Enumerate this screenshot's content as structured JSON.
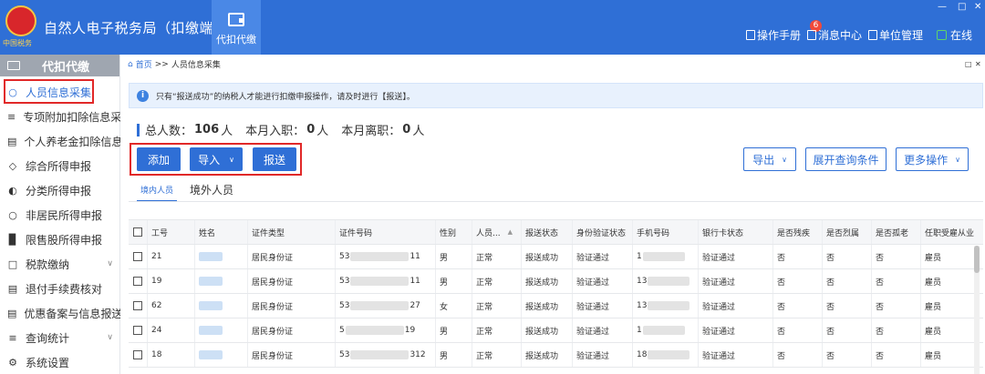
{
  "app": {
    "logo_text": "中国税务",
    "title": "自然人电子税务局（扣缴端）",
    "nav_tab": "代扣代缴"
  },
  "top_right": {
    "manual": "操作手册",
    "messages": "消息中心",
    "message_count": "6",
    "unit_mgmt": "单位管理",
    "online": "在线"
  },
  "sidebar": {
    "header": "代扣代缴",
    "items": [
      {
        "label": "人员信息采集",
        "icon": "person-icon"
      },
      {
        "label": "专项附加扣除信息采集",
        "icon": "list-icon"
      },
      {
        "label": "个人养老金扣除信息",
        "icon": "document-icon"
      },
      {
        "label": "综合所得申报",
        "icon": "layers-icon"
      },
      {
        "label": "分类所得申报",
        "icon": "pie-icon"
      },
      {
        "label": "非居民所得申报",
        "icon": "person-icon"
      },
      {
        "label": "限售股所得申报",
        "icon": "bar-chart-icon"
      },
      {
        "label": "税款缴纳",
        "icon": "folder-icon"
      },
      {
        "label": "退付手续费核对",
        "icon": "receipt-icon"
      },
      {
        "label": "优惠备案与信息报送",
        "icon": "document-icon"
      },
      {
        "label": "查询统计",
        "icon": "search-list-icon"
      },
      {
        "label": "系统设置",
        "icon": "gear-icon"
      }
    ]
  },
  "breadcrumb": {
    "home": "首页",
    "sep": ">>",
    "current": "人员信息采集"
  },
  "notice": "只有“报送成功”的纳税人才能进行扣缴申报操作，请及时进行【报送】。",
  "stats": {
    "total_label": "总人数：",
    "total": "106",
    "total_unit": "人",
    "hired_label": "本月入职：",
    "hired": "0",
    "hired_unit": "人",
    "left_label": "本月离职：",
    "left": "0",
    "left_unit": "人"
  },
  "buttons": {
    "add": "添加",
    "import": "导入",
    "submit": "报送",
    "export": "导出",
    "expand_query": "展开查询条件",
    "more_ops": "更多操作"
  },
  "tabs": [
    "境内人员",
    "境外人员"
  ],
  "table": {
    "headers": [
      "工号",
      "姓名",
      "证件类型",
      "证件号码",
      "性别",
      "人员...",
      "报送状态",
      "身份验证状态",
      "手机号码",
      "银行卡状态",
      "是否残疾",
      "是否烈属",
      "是否孤老",
      "任职受雇从业"
    ],
    "rows": [
      {
        "id": "21",
        "id_type": "居民身份证",
        "id_prefix": "53",
        "id_suffix": "11",
        "gender": "男",
        "status": "正常",
        "submit": "报送成功",
        "verify": "验证通过",
        "phone_prefix": "1",
        "bank": "验证通过",
        "disabled": "否",
        "martyr": "否",
        "elderly": "否",
        "employ": "雇员"
      },
      {
        "id": "19",
        "id_type": "居民身份证",
        "id_prefix": "53",
        "id_suffix": "11",
        "gender": "男",
        "status": "正常",
        "submit": "报送成功",
        "verify": "验证通过",
        "phone_prefix": "13",
        "bank": "验证通过",
        "disabled": "否",
        "martyr": "否",
        "elderly": "否",
        "employ": "雇员"
      },
      {
        "id": "62",
        "id_type": "居民身份证",
        "id_prefix": "53",
        "id_suffix": "27",
        "gender": "女",
        "status": "正常",
        "submit": "报送成功",
        "verify": "验证通过",
        "phone_prefix": "13",
        "bank": "验证通过",
        "disabled": "否",
        "martyr": "否",
        "elderly": "否",
        "employ": "雇员"
      },
      {
        "id": "24",
        "id_type": "居民身份证",
        "id_prefix": "5",
        "id_suffix": "19",
        "gender": "男",
        "status": "正常",
        "submit": "报送成功",
        "verify": "验证通过",
        "phone_prefix": "1",
        "bank": "验证通过",
        "disabled": "否",
        "martyr": "否",
        "elderly": "否",
        "employ": "雇员"
      },
      {
        "id": "18",
        "id_type": "居民身份证",
        "id_prefix": "53",
        "id_suffix": "312",
        "gender": "男",
        "status": "正常",
        "submit": "报送成功",
        "verify": "验证通过",
        "phone_prefix": "18",
        "bank": "验证通过",
        "disabled": "否",
        "martyr": "否",
        "elderly": "否",
        "employ": "雇员"
      }
    ]
  }
}
